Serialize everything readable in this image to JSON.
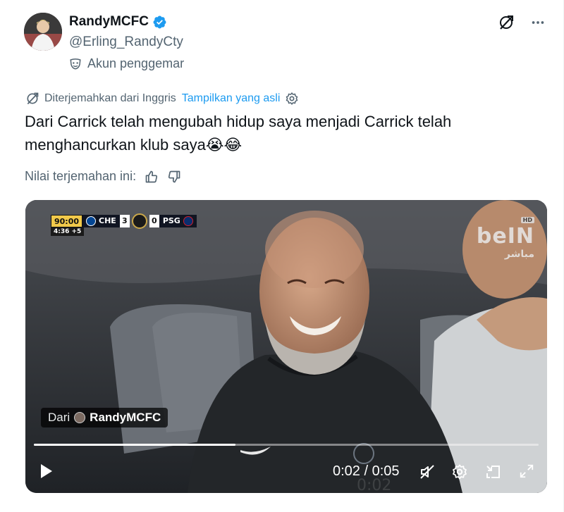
{
  "header": {
    "display_name": "RandyMCFC",
    "handle": "@Erling_RandyCty",
    "fan_label": "Akun penggemar",
    "verified_color": "#1d9bf0"
  },
  "translation": {
    "translated_from": "Diterjemahkan dari Inggris",
    "show_original": "Tampilkan yang asli"
  },
  "tweet": {
    "text": "Dari Carrick telah mengubah hidup saya menjadi Carrick telah menghancurkan klub saya😭😂"
  },
  "rating": {
    "label": "Nilai terjemahan ini:"
  },
  "video": {
    "scorebug": {
      "time": "90:00",
      "home": "CHE",
      "home_score": "3",
      "away_score": "0",
      "away": "PSG",
      "added_time": "4:36 +5"
    },
    "channel": {
      "hd": "HD",
      "name": "beIN",
      "live": "مباشر"
    },
    "source_tag": {
      "from": "Dari",
      "name": "RandyMCFC"
    },
    "progress": 0.4,
    "current_time": "0:02",
    "separator": "/",
    "duration": "0:05"
  },
  "icons": {
    "grok": "grok-slash-icon",
    "more": "more-dots-icon",
    "fan_mask": "mask-icon",
    "translate": "translate-icon",
    "settings": "gear-icon",
    "thumbs_up": "thumbs-up-icon",
    "thumbs_down": "thumbs-down-icon",
    "play": "play-icon",
    "mute": "mute-icon",
    "pip": "pip-icon",
    "fullscreen": "fullscreen-icon"
  }
}
